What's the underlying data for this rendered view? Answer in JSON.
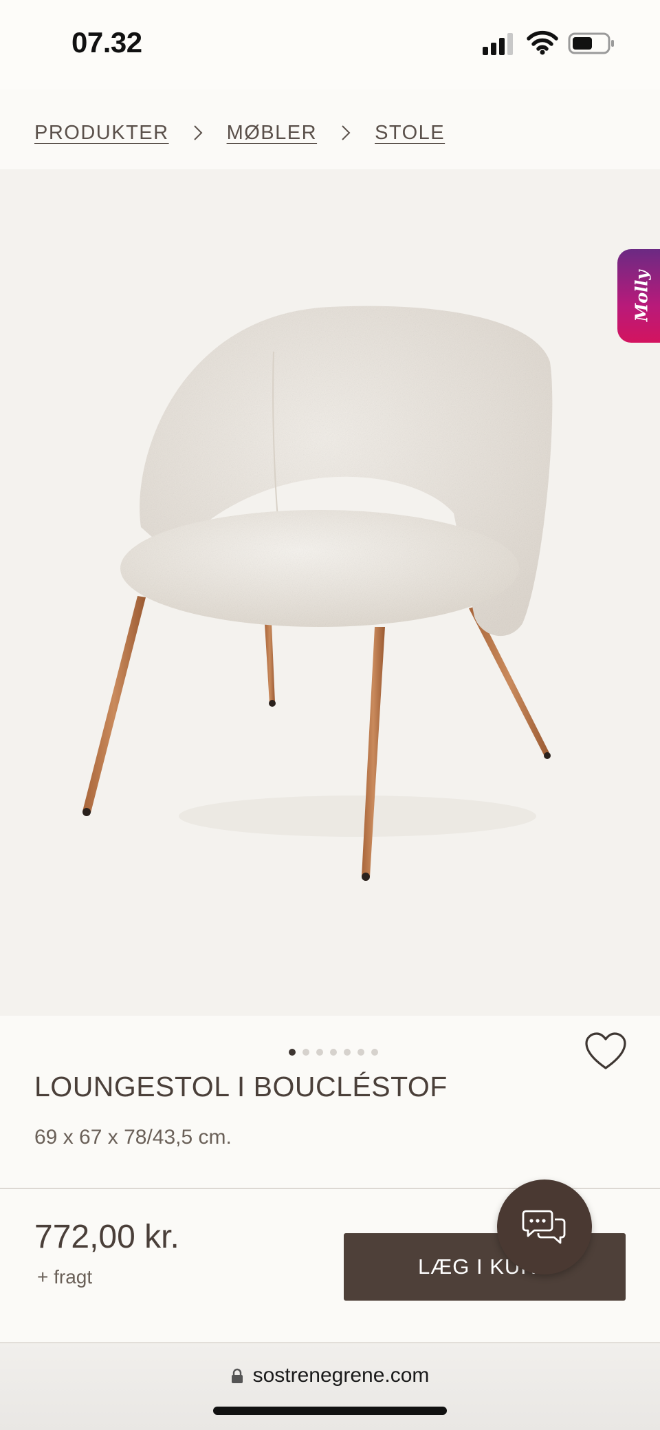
{
  "status_bar": {
    "time": "07.32",
    "signal_icon": "cellular-signal-icon",
    "wifi_icon": "wifi-icon",
    "battery_icon": "battery-icon"
  },
  "breadcrumb": {
    "items": [
      "PRODUKTER",
      "MØBLER",
      "STOLE"
    ],
    "separator_icon": "chevron-right-icon"
  },
  "gallery": {
    "image_alt": "Loungestol i bouclé med træfarvede ben",
    "dots_total": 7,
    "active_dot": 0
  },
  "assistant_tab": {
    "label": "Molly"
  },
  "product": {
    "title": "LOUNGESTOL I BOUCLÉSTOF",
    "dimensions": "69 x 67 x 78/43,5 cm.",
    "wishlist_icon": "heart-outline-icon"
  },
  "purchase": {
    "price": "772,00 kr.",
    "freight_note": "+ fragt",
    "add_to_cart_label": "LÆG I KURV",
    "chat_icon": "chat-bubbles-icon"
  },
  "browser": {
    "url": "sostrenegrene.com",
    "lock_icon": "lock-icon"
  },
  "colors": {
    "page_bg": "#fbfaf7",
    "image_bg": "#f4f2ee",
    "text_primary": "#4a3f39",
    "cta_bg": "#4e4039",
    "chat_bg": "#4a3932",
    "molly_gradient_start": "#6b2a83",
    "molly_gradient_end": "#d3145f"
  }
}
